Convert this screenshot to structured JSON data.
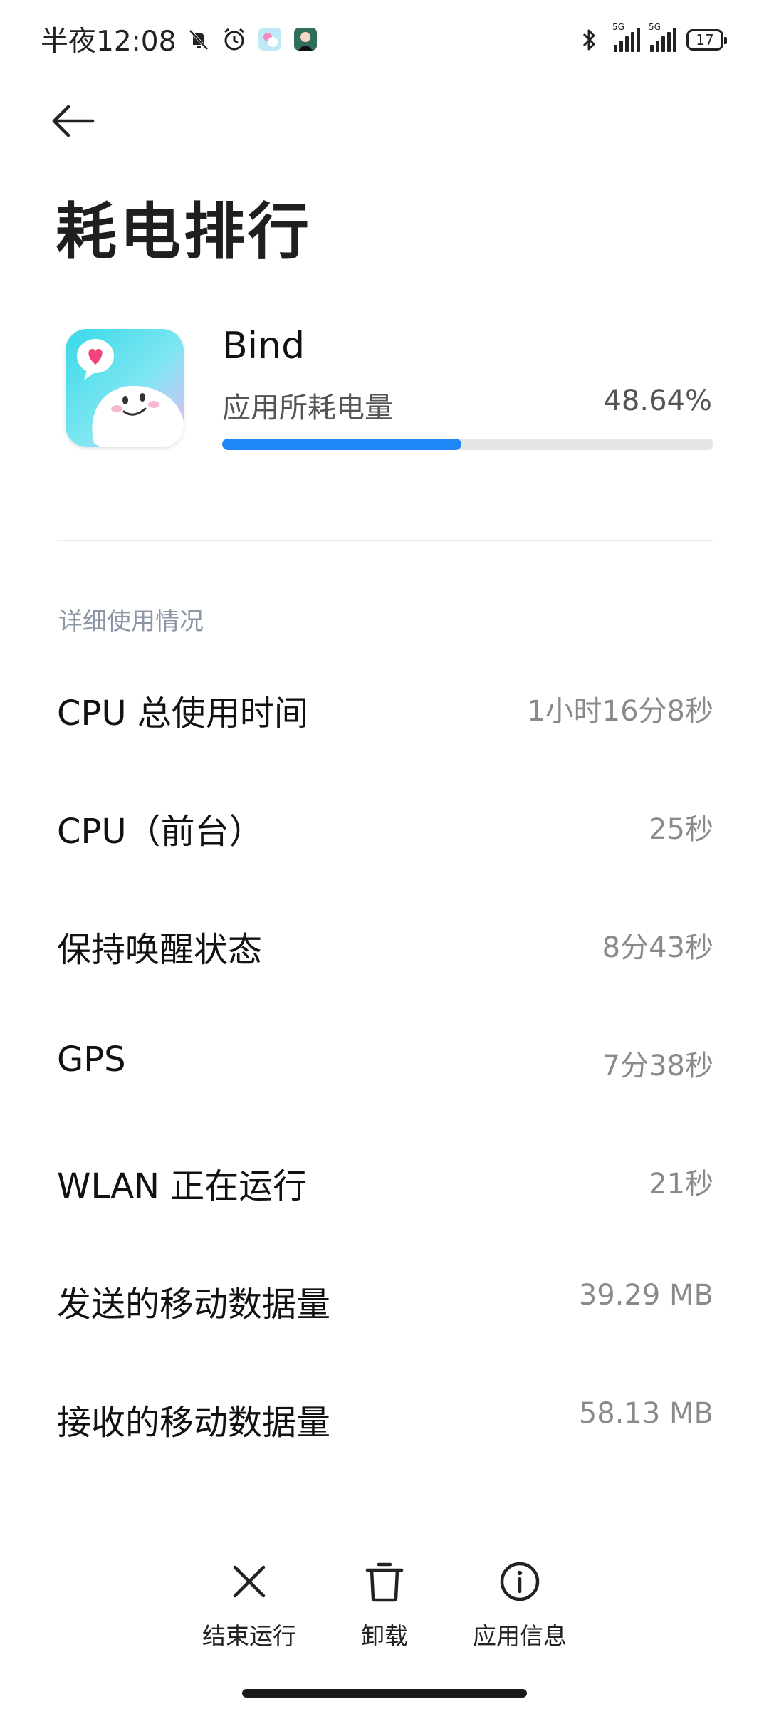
{
  "status_bar": {
    "time": "半夜12:08",
    "network_tag_1": "5G",
    "network_tag_2": "5G",
    "battery_level": "17"
  },
  "header": {
    "title": "耗电排行"
  },
  "app": {
    "name": "Bind",
    "usage_label": "应用所耗电量",
    "usage_percent": "48.64%",
    "usage_fraction": 0.4864,
    "accent_color": "#1e86f5"
  },
  "details": {
    "section_title": "详细使用情况",
    "rows": [
      {
        "label": "CPU 总使用时间",
        "value": "1小时16分8秒"
      },
      {
        "label": "CPU（前台）",
        "value": "25秒"
      },
      {
        "label": "保持唤醒状态",
        "value": "8分43秒"
      },
      {
        "label": "GPS",
        "value": "7分38秒"
      },
      {
        "label": "WLAN 正在运行",
        "value": "21秒"
      },
      {
        "label": "发送的移动数据量",
        "value": "39.29 MB"
      },
      {
        "label": "接收的移动数据量",
        "value": "58.13 MB"
      }
    ]
  },
  "actions": {
    "force_stop": "结束运行",
    "uninstall": "卸载",
    "app_info": "应用信息"
  },
  "icons": {
    "back": "back-arrow-icon",
    "force_stop": "close-icon",
    "uninstall": "trash-icon",
    "app_info": "info-icon"
  }
}
